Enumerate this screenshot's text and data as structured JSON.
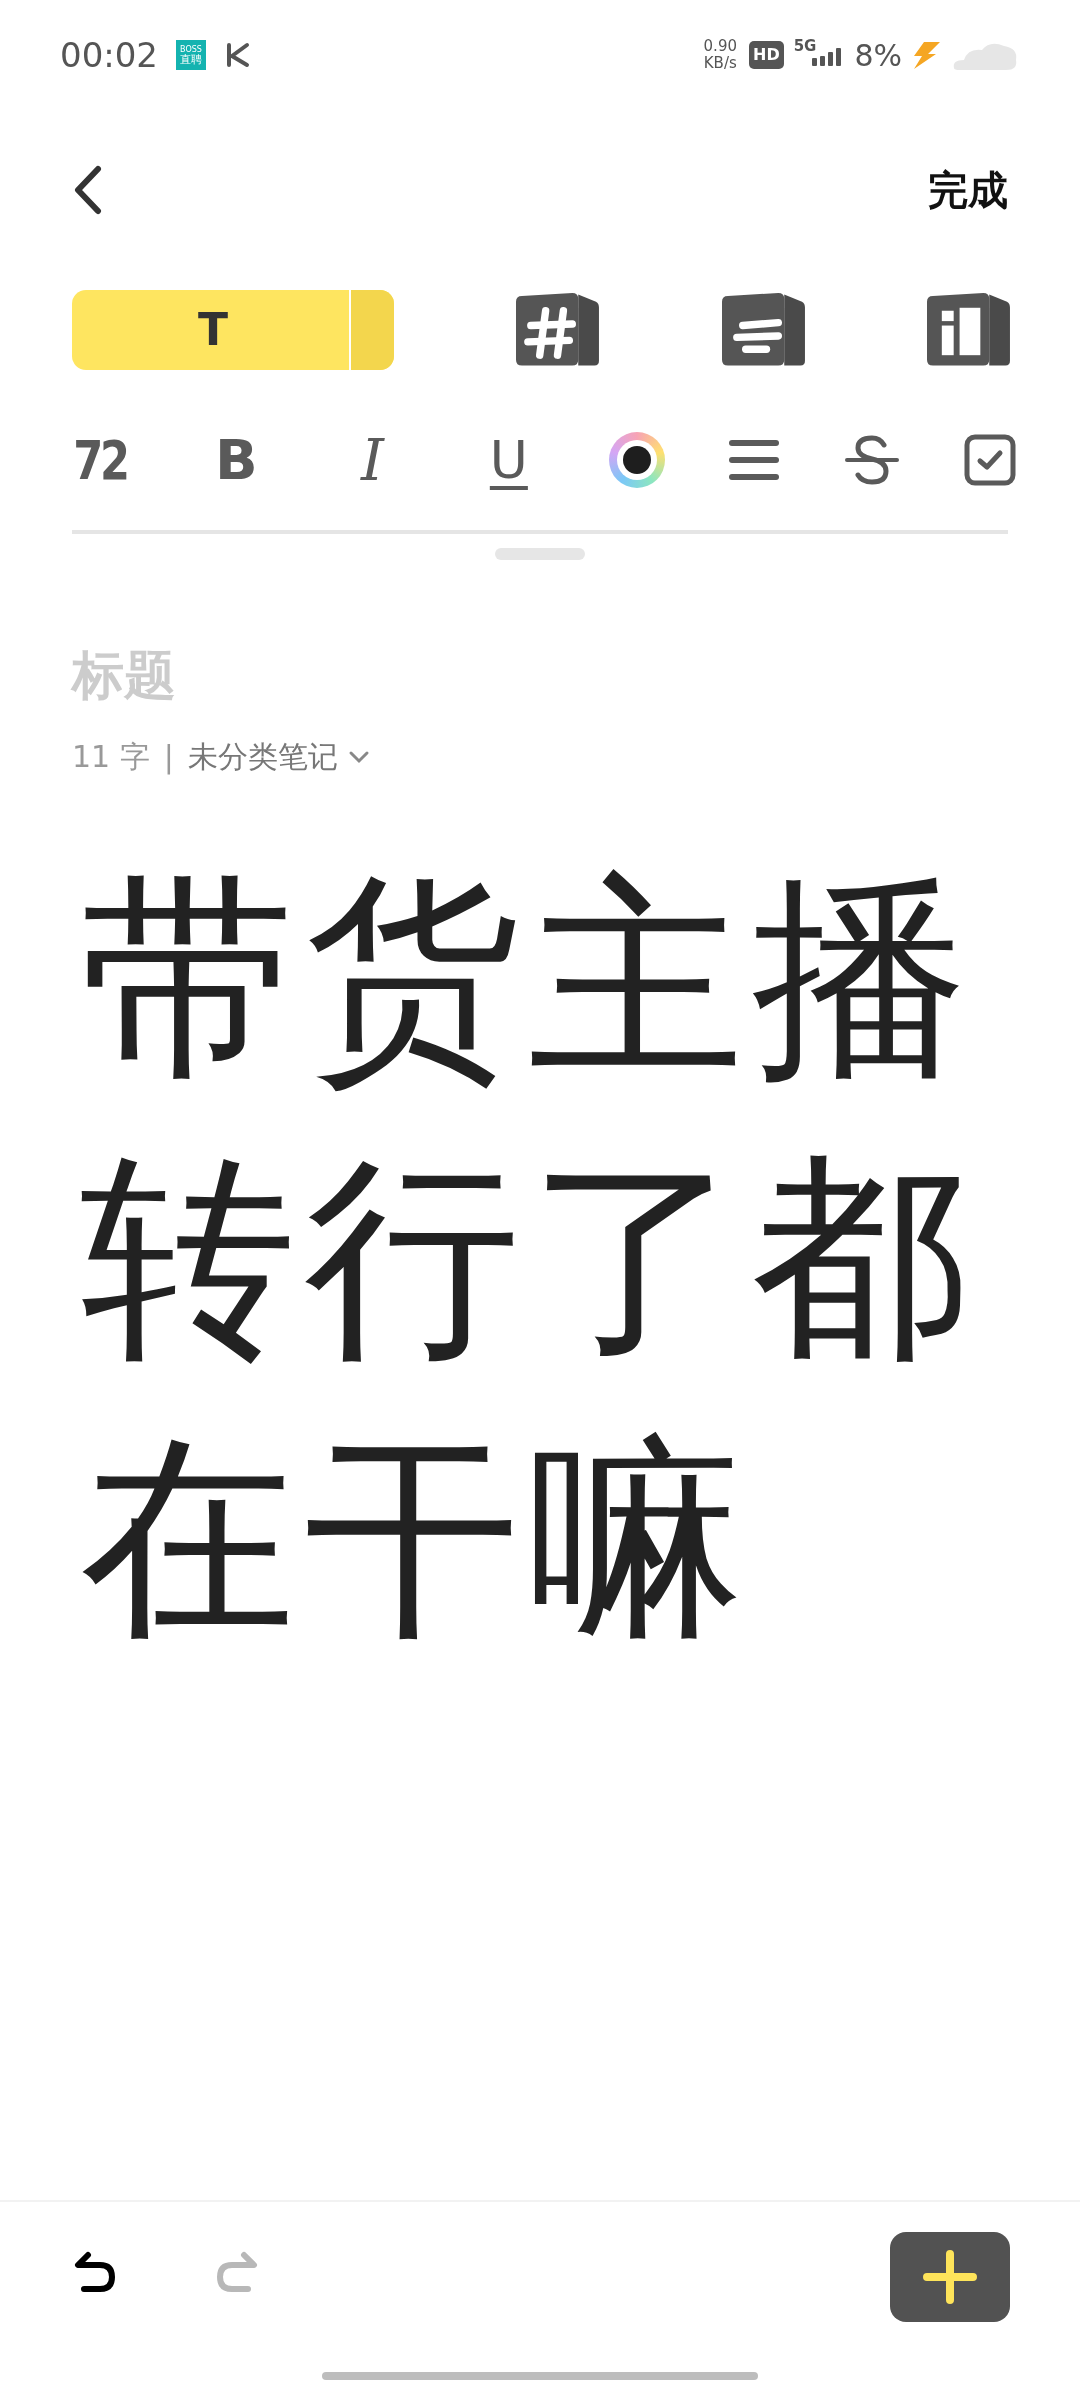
{
  "status_bar": {
    "time": "00:02",
    "app_badge": "BOSS",
    "app_badge_sub": "直聘",
    "net_speed": "0.90",
    "net_unit": "KB/s",
    "hd": "HD",
    "network": "5G",
    "battery": "8%"
  },
  "header": {
    "done": "完成"
  },
  "style_tabs": [
    {
      "kind": "text",
      "label": "T",
      "selected": true
    },
    {
      "kind": "hash",
      "selected": false
    },
    {
      "kind": "lines",
      "selected": false
    },
    {
      "kind": "columns",
      "selected": false
    }
  ],
  "format_tools": [
    {
      "kind": "size",
      "label": "72"
    },
    {
      "kind": "bold",
      "label": "B"
    },
    {
      "kind": "italic",
      "label": "I"
    },
    {
      "kind": "underline",
      "label": "U"
    },
    {
      "kind": "color"
    },
    {
      "kind": "align"
    },
    {
      "kind": "strike"
    },
    {
      "kind": "checkbox"
    }
  ],
  "note": {
    "title_placeholder": "标题",
    "count": "11 字",
    "separator": "|",
    "category": "未分类笔记",
    "body": "带货主播转行了都在干嘛"
  },
  "bottom_bar": {
    "undo_enabled": true,
    "redo_enabled": false
  }
}
